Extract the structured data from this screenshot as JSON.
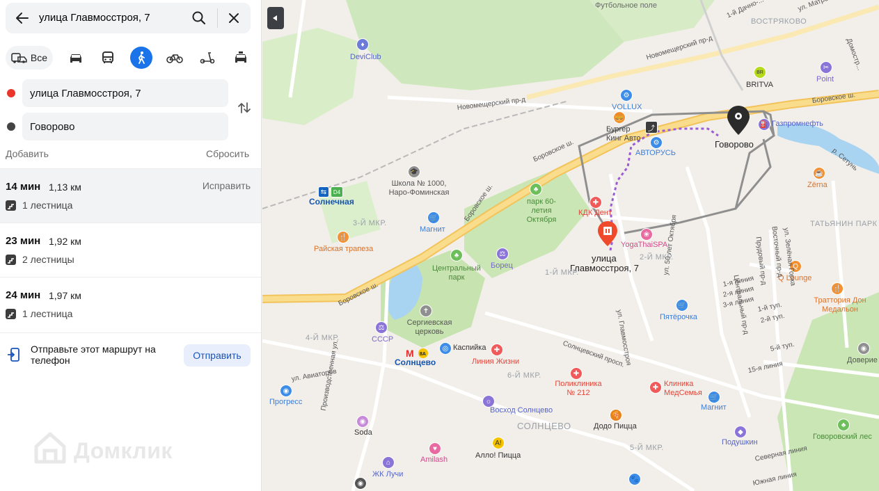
{
  "search": {
    "query": "улица Главмосстроя, 7"
  },
  "modes": {
    "all_label": "Все",
    "selected": "walk",
    "icons": [
      "car-icon",
      "bus-icon",
      "walk-icon",
      "bicycle-icon",
      "scooter-icon",
      "taxi-icon"
    ]
  },
  "route_points": {
    "from": "улица Главмосстроя, 7",
    "to": "Говорово"
  },
  "actions": {
    "add": "Добавить",
    "reset": "Сбросить"
  },
  "routes": [
    {
      "time": "14 мин",
      "distance": "1,13 км",
      "stairs": "1 лестница",
      "fix": "Исправить"
    },
    {
      "time": "23 мин",
      "distance": "1,92 км",
      "stairs": "2 лестницы"
    },
    {
      "time": "24 мин",
      "distance": "1,97 км",
      "stairs": "1 лестница"
    }
  ],
  "share": {
    "text": "Отправьте этот маршрут на телефон",
    "button": "Отправить"
  },
  "watermark": "Домклик",
  "colors": {
    "accent": "#1a73e8",
    "route_line": "#9c5bd6",
    "marker": "#f04a2c",
    "road_main": "#f7d37a",
    "park": "#c9e6b4"
  },
  "map": {
    "origin_label": "улица Главмосстроя, 7",
    "destination_label": "Говорово",
    "districts": [
      "ВОСТРЯКОВО",
      "ТАТЬЯНИН ПАРК",
      "СОЛНЦЕВО",
      "1-Й МКР.",
      "2-Й МКР.",
      "3-Й МКР.",
      "4-Й МКР.",
      "5-Й МКР.",
      "6-Й МКР."
    ],
    "pois": [
      "Футбольное поле",
      "DeviClub",
      "BRITVA",
      "Point",
      "VOLLUX",
      "Бургер Кинг Авто",
      "АВТОРУСЬ",
      "Газпромнефть",
      "Школа № 1000, Наро-Фоминская",
      "Солнечная",
      "парк 60-летия Октября",
      "КДК Дент",
      "Zёrna",
      "Магнит",
      "Райская трапеза",
      "YogaThaiSPA",
      "Борец",
      "Центральный парк",
      "Q Lounge",
      "Траттория Дон Медальон",
      "Пятёрочка",
      "Сергиевская церковь",
      "СССР",
      "Солнцево",
      "Каспийка",
      "Линия Жизни",
      "Прогресс",
      "Поликлиника № 212",
      "Клиника МедСемья",
      "Магнит",
      "Доверие",
      "Восход Солнцево",
      "Додо Пицца",
      "Soda",
      "Подушкин",
      "Говоровский лес",
      "Amilash",
      "Алло! Пицца",
      "ЖК Лучи"
    ],
    "streets": [
      "Боровское ш.",
      "Новомещерский пр-д",
      "1-й Дачно-...",
      "ул. Матро...",
      "ул. Авиаторов",
      "Производственная ул.",
      "Солнцевский просп.",
      "ул. 50 лет Октября",
      "ул. Главмосстроя",
      "Центральный пр-д",
      "Прудовый пр-д",
      "Восточный пр-д",
      "ул. Зелёная Горка",
      "Северная линия",
      "Южная линия",
      "15-я линия",
      "1-я линия",
      "2-я линия",
      "3-я линия",
      "1-й туп.",
      "2-й туп.",
      "5-й туп.",
      "р. Сетунь",
      "Домостр..."
    ]
  }
}
